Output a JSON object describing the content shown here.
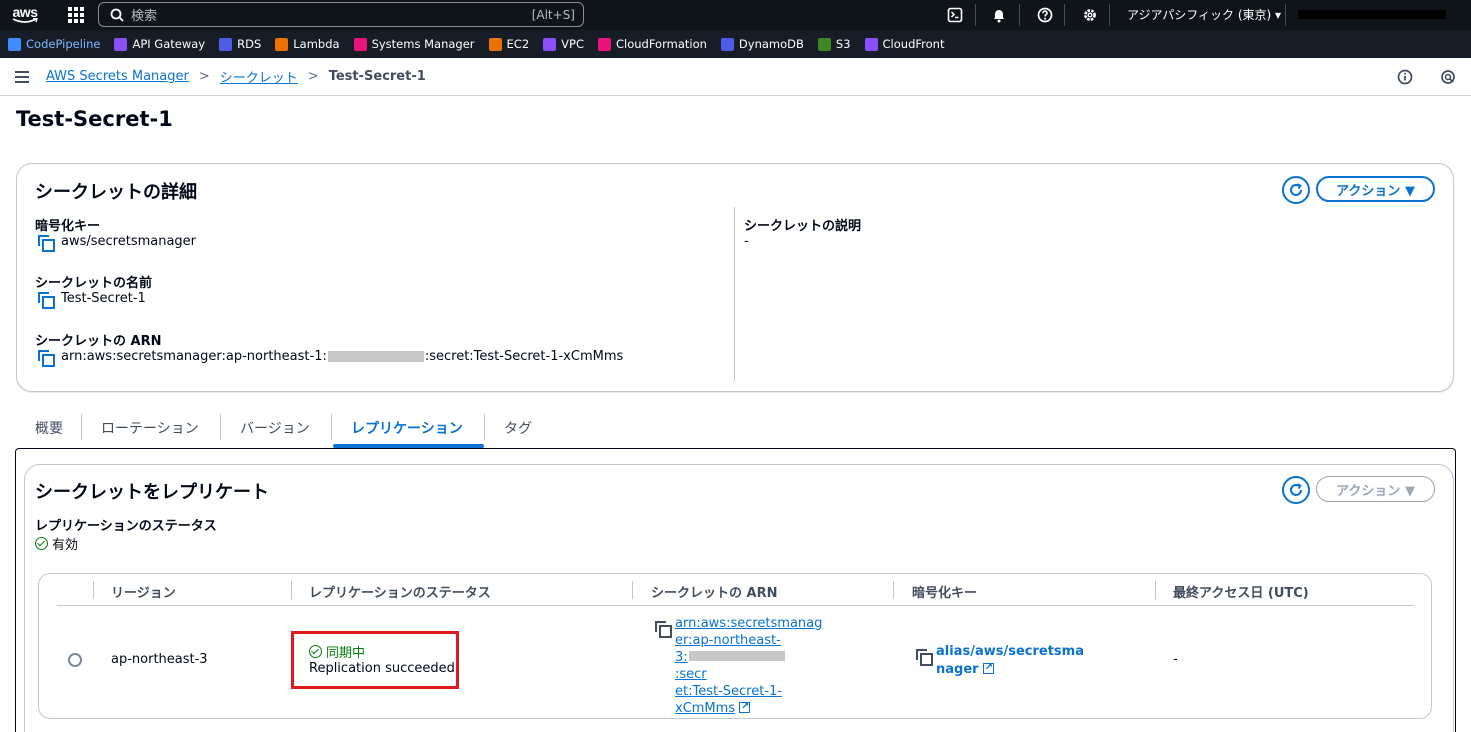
{
  "topnav": {
    "logo_text": "aws",
    "search_placeholder": "検索",
    "search_shortcut": "[Alt+S]",
    "region": "アジアパシフィック (東京) ▾"
  },
  "favorites": [
    {
      "label": "CodePipeline",
      "color": "#3f8bff"
    },
    {
      "label": "API Gateway",
      "color": "#8a4ff5"
    },
    {
      "label": "RDS",
      "color": "#4d5ce6"
    },
    {
      "label": "Lambda",
      "color": "#ed7100"
    },
    {
      "label": "Systems Manager",
      "color": "#e7157b"
    },
    {
      "label": "EC2",
      "color": "#ed7100"
    },
    {
      "label": "VPC",
      "color": "#8c4fff"
    },
    {
      "label": "CloudFormation",
      "color": "#e7157b"
    },
    {
      "label": "DynamoDB",
      "color": "#4d5ce6"
    },
    {
      "label": "S3",
      "color": "#3f8624"
    },
    {
      "label": "CloudFront",
      "color": "#8c4fff"
    }
  ],
  "breadcrumb": {
    "root": "AWS Secrets Manager",
    "section": "シークレット",
    "current": "Test-Secret-1"
  },
  "page_title": "Test-Secret-1",
  "details": {
    "title": "シークレットの詳細",
    "action_label": "アクション ▼",
    "encryption_key_label": "暗号化キー",
    "encryption_key_value": "aws/secretsmanager",
    "name_label": "シークレットの名前",
    "name_value": "Test-Secret-1",
    "arn_label": "シークレットの ARN",
    "arn_prefix": "arn:aws:secretsmanager:ap-northeast-1:",
    "arn_suffix": ":secret:Test-Secret-1-xCmMms",
    "description_label": "シークレットの説明",
    "description_value": "-"
  },
  "tabs": [
    "概要",
    "ローテーション",
    "バージョン",
    "レプリケーション",
    "タグ"
  ],
  "replication": {
    "title": "シークレットをレプリケート",
    "action_label": "アクション ▼",
    "status_label": "レプリケーションのステータス",
    "status_value": "有効",
    "table": {
      "headers": [
        "リージョン",
        "レプリケーションのステータス",
        "シークレットの ARN",
        "暗号化キー",
        "最終アクセス日 (UTC)"
      ],
      "rows": [
        {
          "region": "ap-northeast-3",
          "status": "同期中",
          "status_detail": "Replication succeeded",
          "arn_line1": "arn:aws:secretsmanag",
          "arn_line2": "er:ap-northeast-",
          "arn_line3_prefix": "3:",
          "arn_line3_suffix": ":secr",
          "arn_line4": "et:Test-Secret-1-",
          "arn_line5": "xCmMms",
          "key_line1": "alias/aws/secretsma",
          "key_line2": "nager",
          "last_accessed": "-"
        }
      ]
    }
  },
  "colors": {
    "accent": "#0972d3",
    "success": "#037f0c",
    "highlight": "#e1171e",
    "nav_bg": "#0f141a"
  }
}
